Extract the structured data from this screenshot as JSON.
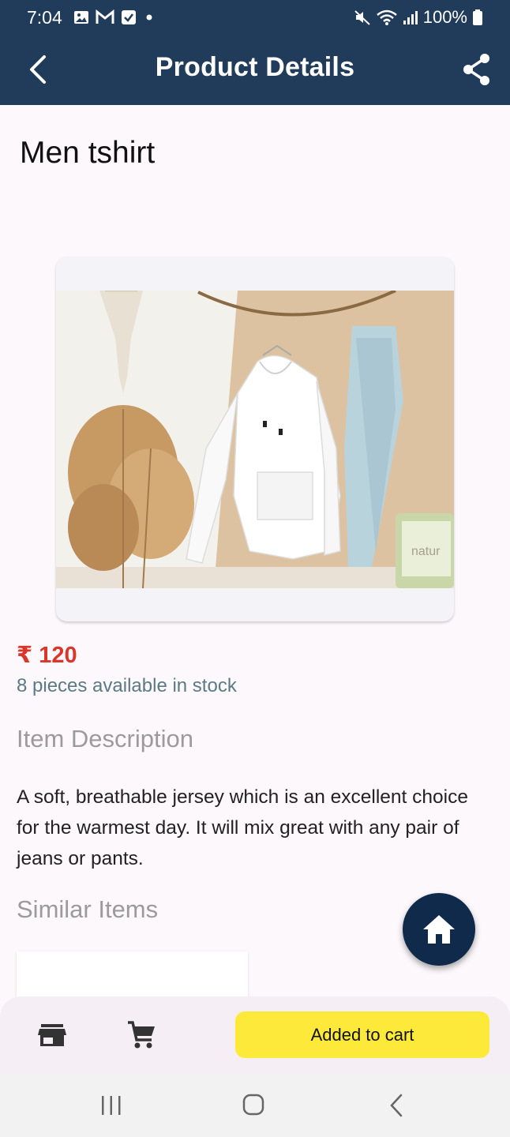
{
  "status_bar": {
    "time": "7:04",
    "battery": "100%",
    "icons_left": [
      "gallery-icon",
      "gmail-icon",
      "check-icon",
      "dot-icon"
    ],
    "icons_right": [
      "mute-icon",
      "wifi-icon",
      "signal-icon",
      "battery-icon"
    ]
  },
  "app_bar": {
    "title": "Product Details",
    "back_icon": "arrow-back-icon",
    "share_icon": "share-icon",
    "background": "#213b5a"
  },
  "product": {
    "name": "Men tshirt",
    "price": "₹ 120",
    "stock": "8 pieces available in stock",
    "description_title": "Item Description",
    "description": "A soft, breathable jersey which is an excellent choice for the warmest day. It will mix great with any pair of jeans or pants.",
    "similar_title": "Similar Items"
  },
  "image_text": "natur",
  "colors": {
    "price": "#d9372a",
    "stock": "#5c7a83",
    "accent_button": "#fde93a",
    "fab": "#0f2a4a"
  },
  "fab": {
    "icon": "home-icon"
  },
  "bottom_bar": {
    "store_icon": "store-icon",
    "cart_icon": "cart-icon",
    "add_to_cart_label": "Added to cart"
  },
  "nav_bar": {
    "icons": [
      "recents-icon",
      "home-circle-icon",
      "back-chevron-icon"
    ]
  }
}
